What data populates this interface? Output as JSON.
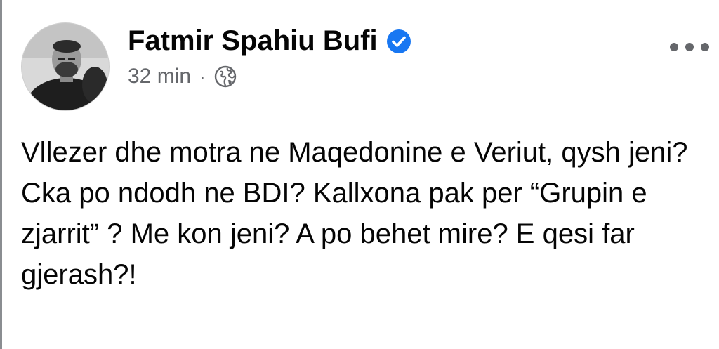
{
  "post": {
    "author_name": "Fatmir Spahiu Bufi",
    "verified": true,
    "timestamp": "32 min",
    "separator": "·",
    "privacy_icon": "globe-icon",
    "more_icon": "more-options-icon",
    "paragraphs": [
      "Vllezer dhe motra ne Maqedonine e Veriut, qysh jeni?",
      "Cka po ndodh ne BDI? Kallxona pak per “Grupin e zjarrit” ? Me kon jeni? A po behet mire? E qesi far gjerash?!"
    ]
  },
  "colors": {
    "verified_badge": "#1877f2",
    "meta_text": "#65676b",
    "body_text": "#050505"
  }
}
